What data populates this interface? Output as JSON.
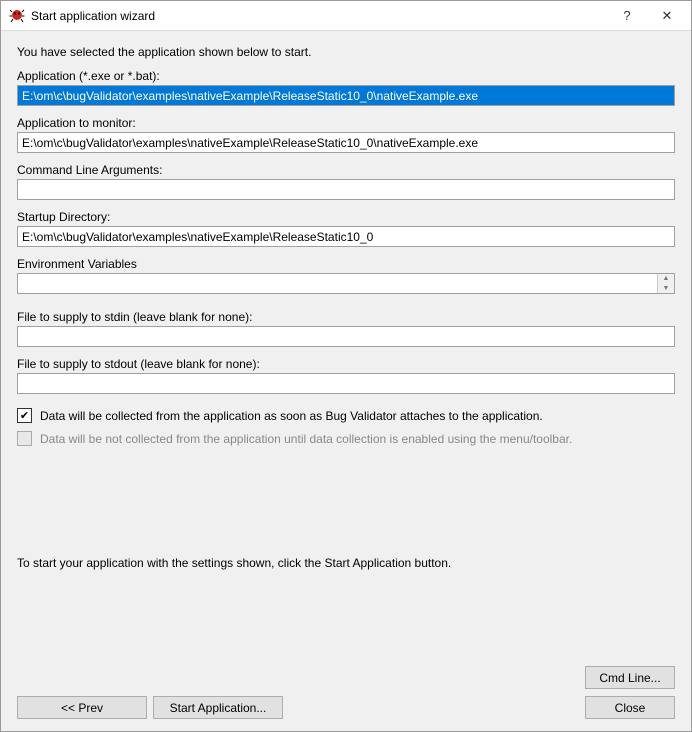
{
  "titlebar": {
    "title": "Start application wizard",
    "help_label": "?",
    "close_label": "✕"
  },
  "intro_text": "You have selected the application shown below to start.",
  "fields": {
    "application": {
      "label": "Application (*.exe or *.bat):",
      "value": "E:\\om\\c\\bugValidator\\examples\\nativeExample\\ReleaseStatic10_0\\nativeExample.exe"
    },
    "monitor": {
      "label": "Application to monitor:",
      "value": "E:\\om\\c\\bugValidator\\examples\\nativeExample\\ReleaseStatic10_0\\nativeExample.exe"
    },
    "cmdargs": {
      "label": "Command Line Arguments:",
      "value": ""
    },
    "startup_dir": {
      "label": "Startup Directory:",
      "value": "E:\\om\\c\\bugValidator\\examples\\nativeExample\\ReleaseStatic10_0"
    },
    "env_vars": {
      "label": "Environment Variables",
      "value": ""
    },
    "stdin": {
      "label": "File to supply to stdin (leave blank for none):",
      "value": ""
    },
    "stdout": {
      "label": "File to supply to stdout (leave blank for none):",
      "value": ""
    }
  },
  "checkboxes": {
    "collect_on_attach": "Data will be collected from the application as soon as Bug Validator attaches to the application.",
    "collect_disabled": "Data will be not collected from the application until data collection is enabled using the menu/toolbar."
  },
  "bottom_text": "To start your application with the settings shown, click the Start Application button.",
  "buttons": {
    "cmdline": "Cmd Line...",
    "prev": "<< Prev",
    "start": "Start Application...",
    "close": "Close"
  }
}
